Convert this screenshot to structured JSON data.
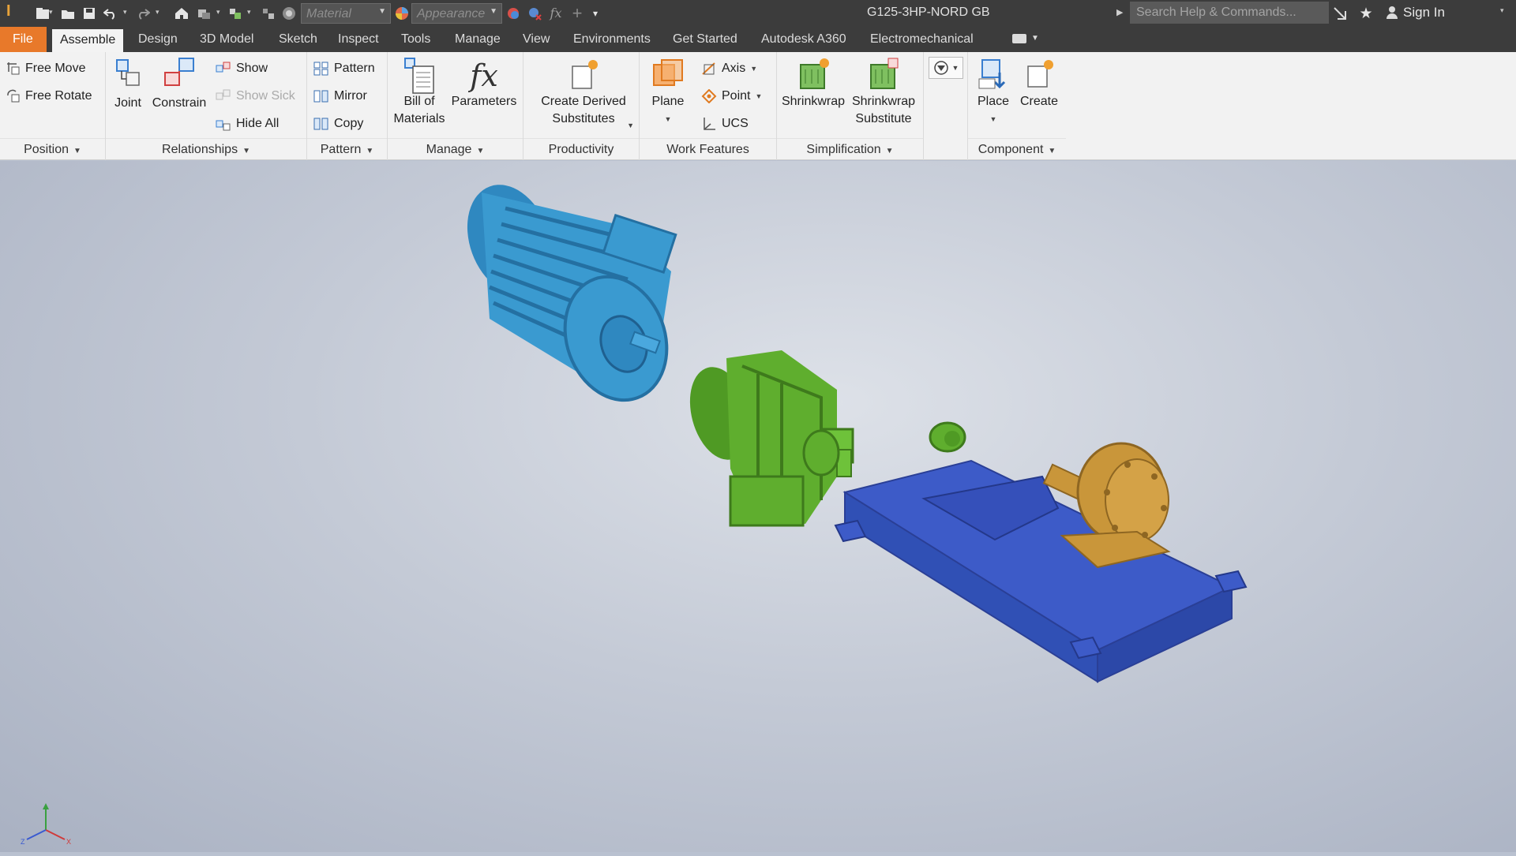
{
  "titlebar": {
    "app_logo": "I",
    "material_placeholder": "Material",
    "appearance_placeholder": "Appearance",
    "document_title": "G125-3HP-NORD GB",
    "search_placeholder": "Search Help & Commands...",
    "sign_in": "Sign In",
    "icons": [
      "new-icon",
      "open-icon",
      "save-icon",
      "undo-icon",
      "redo-icon",
      "home-icon",
      "return-icon",
      "select-icon",
      "update-icon",
      "iproperties-icon",
      "appearance-icon",
      "adjust-icon",
      "clear-icon",
      "fx-icon",
      "crosshair-icon",
      "customize-icon",
      "exchange-icon",
      "star-icon",
      "user-icon"
    ]
  },
  "tabs": {
    "file": "File",
    "assemble": "Assemble",
    "design": "Design",
    "model3d": "3D Model",
    "sketch": "Sketch",
    "inspect": "Inspect",
    "tools": "Tools",
    "manage": "Manage",
    "view": "View",
    "environments": "Environments",
    "get_started": "Get Started",
    "a360": "Autodesk A360",
    "electromechanical": "Electromechanical"
  },
  "ribbon": {
    "position": {
      "title": "Position",
      "free_move": "Free Move",
      "free_rotate": "Free Rotate"
    },
    "relationships": {
      "title": "Relationships",
      "joint": "Joint",
      "constrain": "Constrain",
      "show": "Show",
      "show_sick": "Show Sick",
      "hide_all": "Hide All"
    },
    "pattern": {
      "title": "Pattern",
      "pattern": "Pattern",
      "mirror": "Mirror",
      "copy": "Copy"
    },
    "manage": {
      "title": "Manage",
      "bom_line1": "Bill of",
      "bom_line2": "Materials",
      "parameters": "Parameters"
    },
    "productivity": {
      "title": "Productivity",
      "line1": "Create Derived",
      "line2": "Substitutes"
    },
    "work_features": {
      "title": "Work Features",
      "plane": "Plane",
      "axis": "Axis",
      "point": "Point",
      "ucs": "UCS"
    },
    "simplification": {
      "title": "Simplification",
      "shrinkwrap": "Shrinkwrap",
      "sws_line1": "Shrinkwrap",
      "sws_line2": "Substitute"
    },
    "component": {
      "title": "Component",
      "place": "Place",
      "create": "Create"
    }
  },
  "colors": {
    "motor": "#3a9ad0",
    "gearbox": "#5fae2e",
    "baseplate": "#3d5bc8",
    "pump": "#c9963a",
    "file_tab": "#e8792a"
  }
}
